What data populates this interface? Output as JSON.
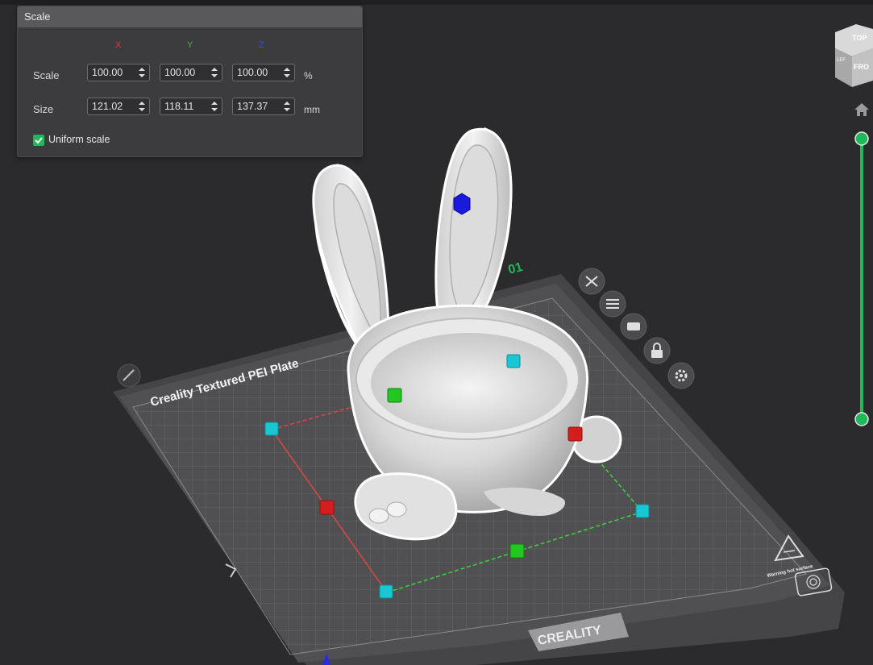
{
  "scale_panel": {
    "title": "Scale",
    "axes": {
      "x": "X",
      "y": "Y",
      "z": "Z"
    },
    "rows": {
      "scale": {
        "label": "Scale",
        "x": "100.00",
        "y": "100.00",
        "z": "100.00",
        "unit": "%"
      },
      "size": {
        "label": "Size",
        "x": "121.02",
        "y": "118.11",
        "z": "137.37",
        "unit": "mm"
      }
    },
    "uniform_scale": {
      "label": "Uniform scale",
      "checked": true
    }
  },
  "view_cube": {
    "top": "TOP",
    "front": "FRO",
    "left": "LEF"
  },
  "plate": {
    "name": "Creality Textured PEI Plate",
    "number": "01",
    "brand": "CREALITY",
    "warning": "Warning hot surface"
  },
  "colors": {
    "accent": "#1fb95c",
    "axis_x": "#d33a3a",
    "axis_y": "#2ec22e",
    "axis_z": "#3a4ae0",
    "handle_cyan": "#19c6d4"
  },
  "icons": [
    "close-icon",
    "list-icon",
    "auto-arrange-icon",
    "lock-icon",
    "gear-icon",
    "home-icon",
    "edit-icon"
  ]
}
